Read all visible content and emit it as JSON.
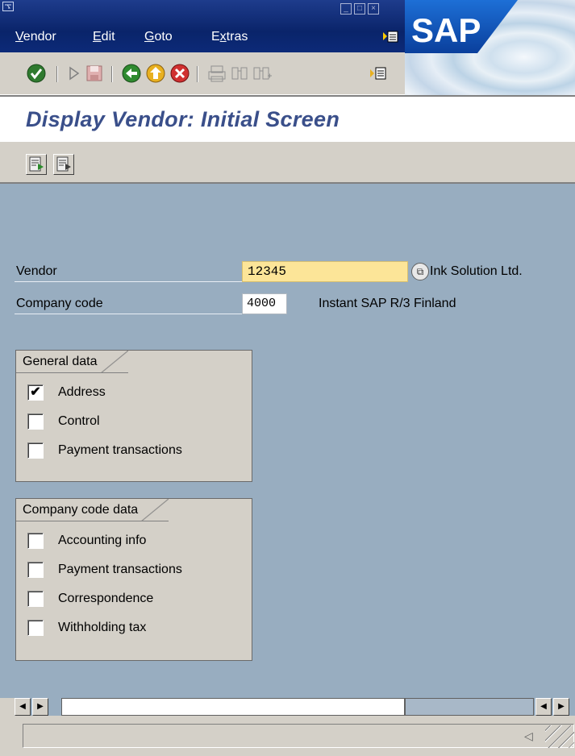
{
  "menu": {
    "items": [
      {
        "label": "Vendor"
      },
      {
        "label": "Edit"
      },
      {
        "label": "Goto"
      },
      {
        "label": "Extras"
      }
    ]
  },
  "logo": {
    "text": "SAP"
  },
  "page": {
    "title": "Display Vendor:  Initial Screen"
  },
  "fields": {
    "vendor": {
      "label": "Vendor",
      "value": "12345",
      "description": "Ink Solution Ltd."
    },
    "company_code": {
      "label": "Company code",
      "value": "4000",
      "description": "Instant SAP R/3 Finland"
    }
  },
  "general_data": {
    "title": "General data",
    "options": [
      {
        "label": "Address",
        "checked": true
      },
      {
        "label": "Control",
        "checked": false
      },
      {
        "label": "Payment transactions",
        "checked": false
      }
    ]
  },
  "company_code_data": {
    "title": "Company code data",
    "options": [
      {
        "label": "Accounting info",
        "checked": false
      },
      {
        "label": "Payment transactions",
        "checked": false
      },
      {
        "label": "Correspondence",
        "checked": false
      },
      {
        "label": "Withholding tax",
        "checked": false
      }
    ]
  },
  "colors": {
    "menubar": "#0a246a",
    "title_text": "#3a4f8a",
    "work_area": "#98adc0",
    "required_field": "#fce598"
  }
}
